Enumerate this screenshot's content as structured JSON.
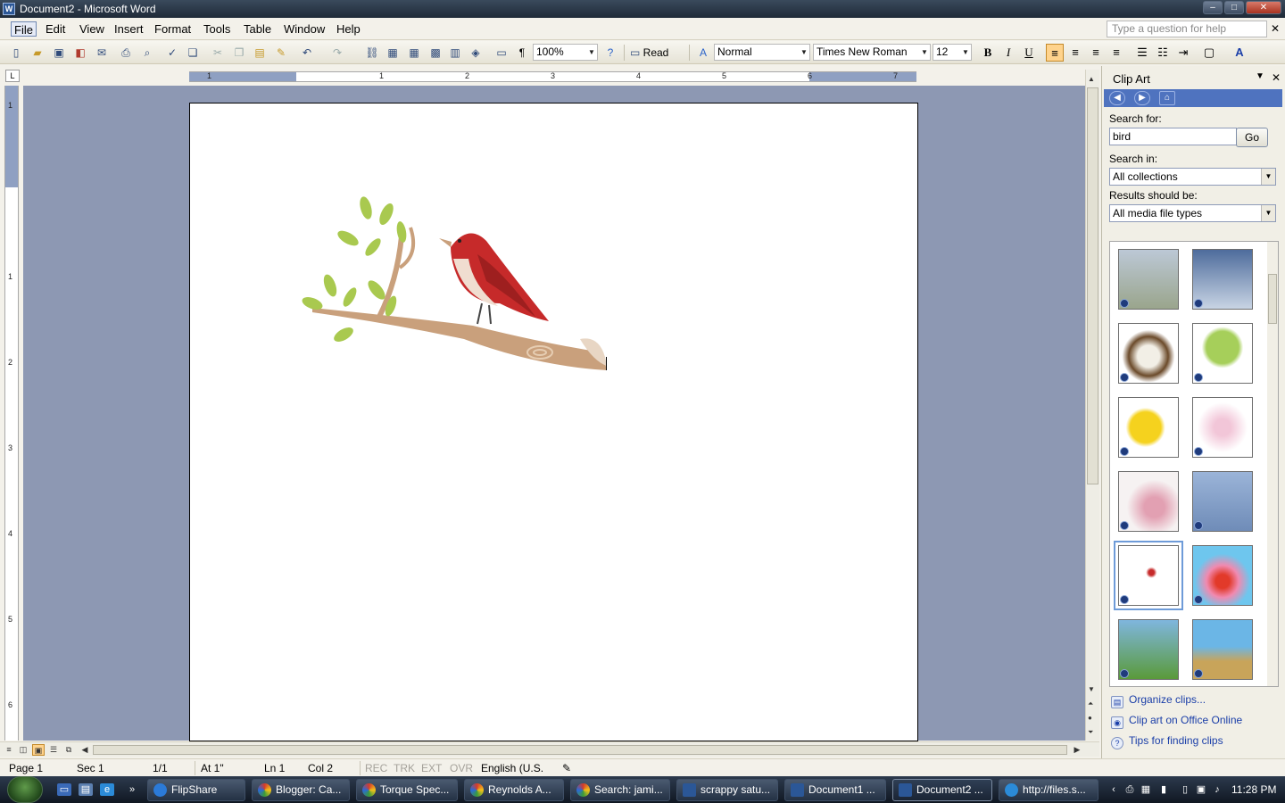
{
  "window": {
    "title": "Document2 - Microsoft Word",
    "min": "–",
    "max": "□",
    "close": "✕"
  },
  "menu": [
    "File",
    "Edit",
    "View",
    "Insert",
    "Format",
    "Tools",
    "Table",
    "Window",
    "Help"
  ],
  "help_box": {
    "placeholder": "Type a question for help"
  },
  "toolbar": {
    "zoom": "100%",
    "read_label": "Read",
    "style": "Normal",
    "font": "Times New Roman",
    "font_size": "12",
    "bold": "B",
    "italic": "I",
    "underline": "U"
  },
  "ruler": {
    "h_numbers": [
      "1",
      "1",
      "2",
      "3",
      "4",
      "5",
      "6",
      "7"
    ],
    "v_numbers": [
      "1",
      "1",
      "2",
      "3",
      "4",
      "5",
      "6"
    ]
  },
  "status": {
    "page": "Page 1",
    "section": "Sec 1",
    "pages": "1/1",
    "at": "At 1\"",
    "line": "Ln 1",
    "col": "Col 2",
    "rec": "REC",
    "trk": "TRK",
    "ext": "EXT",
    "ovr": "OVR",
    "language": "English (U.S."
  },
  "taskpane": {
    "title": "Clip Art",
    "search_for_label": "Search for:",
    "search_value": "bird",
    "go_label": "Go",
    "search_in_label": "Search in:",
    "search_in_value": "All collections",
    "results_label": "Results should be:",
    "results_value": "All media file types",
    "links": [
      "Organize clips...",
      "Clip art on Office Online",
      "Tips for finding clips"
    ],
    "thumbnails": [
      "marsh-bird-photo",
      "eagle-flying-photo",
      "nest-eggs",
      "tree-bird",
      "smiley-bird-cartoon",
      "floral-birds-pattern",
      "pink-flowers-birds",
      "heron-photo",
      "bird-on-branch",
      "bird-sunburst",
      "birds-in-tree",
      "birds-on-hill"
    ]
  },
  "taskbar": {
    "tasks": [
      "FlipShare",
      "Blogger: Ca...",
      "Torque Spec...",
      "Reynolds A...",
      "Search: jami...",
      "scrappy satu...",
      "Document1 ...",
      "Document2 ...",
      "http://files.s..."
    ],
    "time": "11:28 PM"
  }
}
